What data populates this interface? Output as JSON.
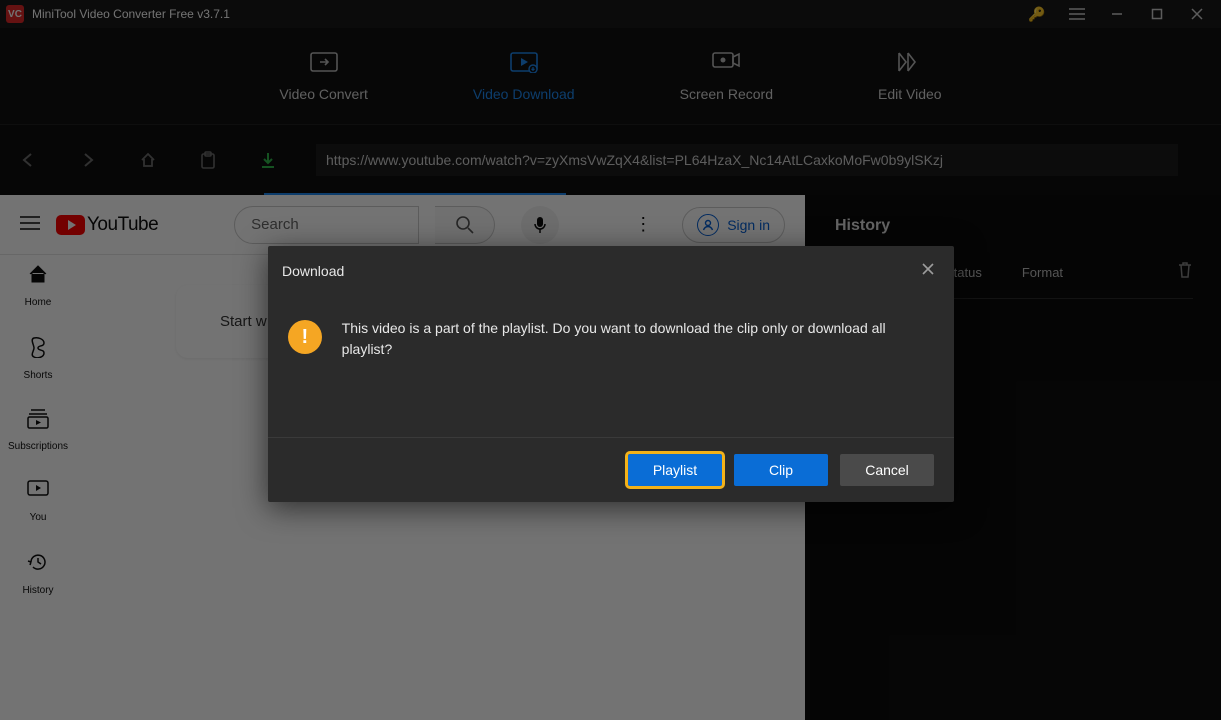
{
  "titlebar": {
    "app_title": "MiniTool Video Converter Free v3.7.1"
  },
  "tabs": {
    "convert": "Video Convert",
    "download": "Video Download",
    "record": "Screen Record",
    "edit": "Edit Video"
  },
  "url": "https://www.youtube.com/watch?v=zyXmsVwZqX4&list=PL64HzaX_Nc14AtLCaxkoMoFw0b9ylSKzj",
  "youtube": {
    "logo_text": "YouTube",
    "search_placeholder": "Search",
    "signin": "Sign in",
    "sidebar": {
      "home": "Home",
      "shorts": "Shorts",
      "subs": "Subscriptions",
      "you": "You",
      "history": "History"
    },
    "chip_text": "Start w"
  },
  "history": {
    "title": "History",
    "col_status": "Status",
    "col_format": "Format"
  },
  "modal": {
    "title": "Download",
    "message": "This video is a part of the playlist. Do you want to download the clip only or download all playlist?",
    "btn_playlist": "Playlist",
    "btn_clip": "Clip",
    "btn_cancel": "Cancel"
  }
}
